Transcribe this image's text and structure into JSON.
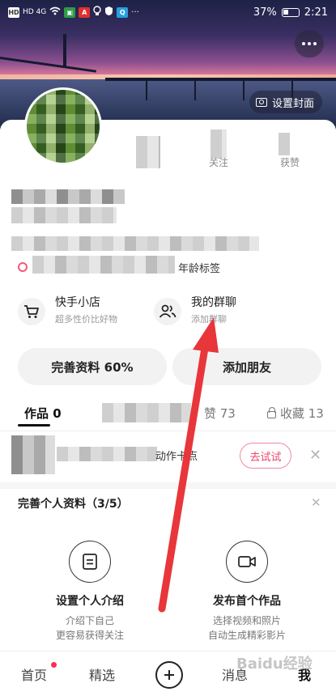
{
  "status_bar": {
    "network": "HD 4G",
    "battery": "37%",
    "time": "2:21",
    "icons": [
      "hd-icon",
      "signal-icon",
      "wifi-icon",
      "app-notify-icon",
      "adobe-icon",
      "bulb-icon",
      "shield-icon",
      "search-icon"
    ]
  },
  "cover": {
    "set_cover_label": "设置封面"
  },
  "profile": {
    "stats": {
      "following_label": "关注",
      "likes_label": "获赞"
    },
    "tag_label": "年龄标签"
  },
  "entries": [
    {
      "title": "快手小店",
      "subtitle": "超多性价比好物",
      "icon": "cart-icon"
    },
    {
      "title": "我的群聊",
      "subtitle": "添加群聊",
      "icon": "group-icon"
    }
  ],
  "actions": {
    "complete_profile": "完善资料 60%",
    "add_friends": "添加朋友"
  },
  "tabs": [
    {
      "label": "作品 0",
      "active": true
    },
    {
      "label": "赞 73",
      "active": false
    },
    {
      "label": "收藏 13",
      "active": false
    }
  ],
  "topic": {
    "text": "动作卡点",
    "try_label": "去试试"
  },
  "completion": {
    "title": "完善个人资料（3/5）",
    "tasks": [
      {
        "title": "设置个人介绍",
        "desc_1": "介绍下自己",
        "desc_2": "更容易获得关注",
        "icon": "profile-card-icon"
      },
      {
        "title": "发布首个作品",
        "desc_1": "选择视频和照片",
        "desc_2": "自动生成精彩影片",
        "icon": "video-icon"
      }
    ]
  },
  "bottom_nav": {
    "home": "首页",
    "featured": "精选",
    "messages": "消息",
    "me": "我"
  },
  "watermark": "Baidu经验",
  "colors": {
    "accent_pink": "#fe2c55",
    "try_border": "#f08aa2",
    "annotation_red": "#e8363b"
  }
}
